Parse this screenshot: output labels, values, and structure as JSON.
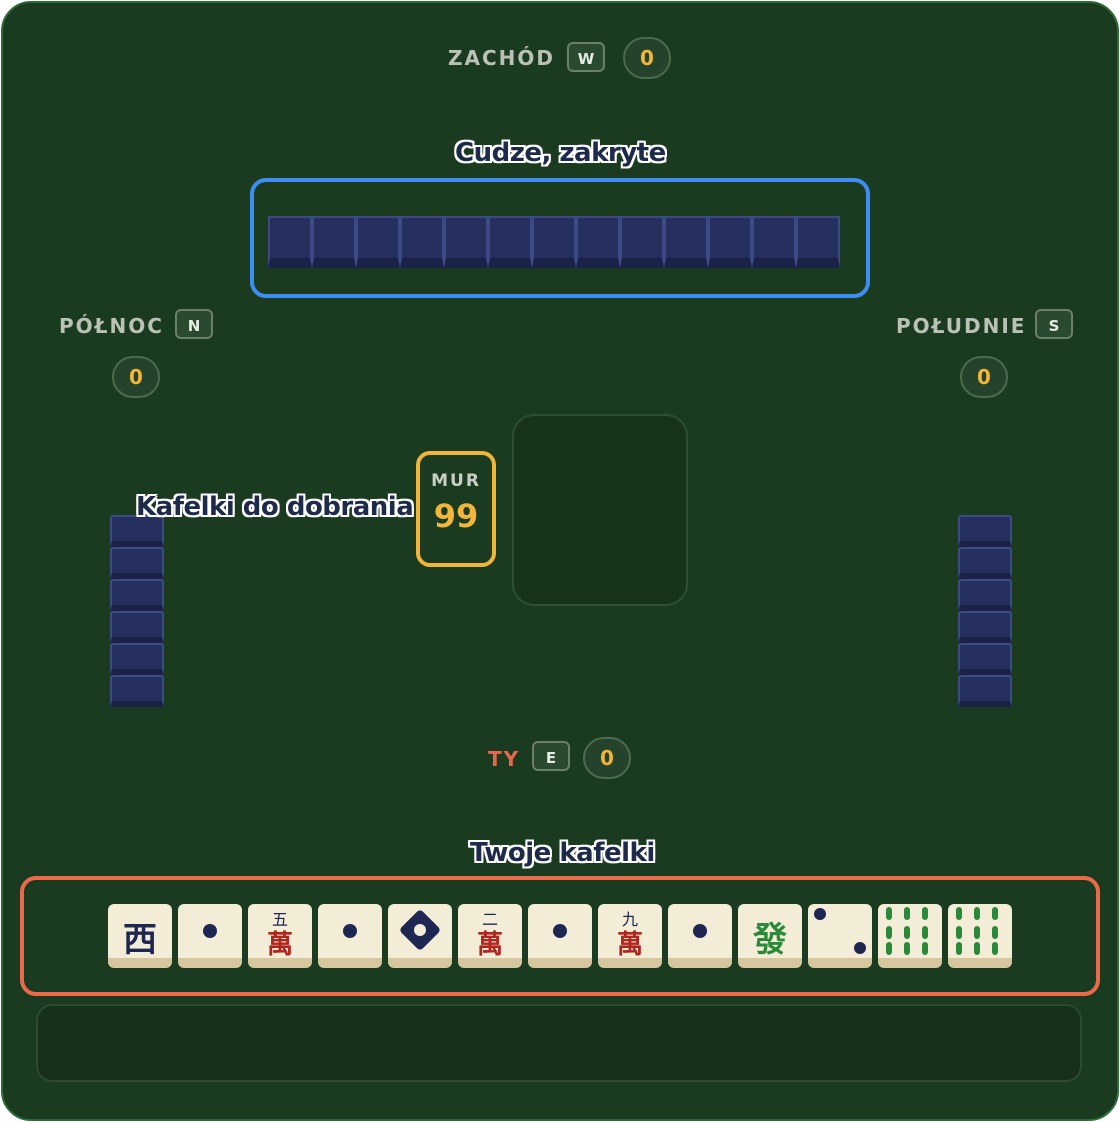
{
  "players": {
    "west": {
      "name": "ZACHÓD",
      "wind": "W",
      "score": "0"
    },
    "north": {
      "name": "PÓŁNOC",
      "wind": "N",
      "score": "0"
    },
    "south": {
      "name": "POŁUDNIE",
      "wind": "S",
      "score": "0"
    },
    "you": {
      "name": "TY",
      "wind": "E",
      "score": "0"
    }
  },
  "annotations": {
    "hidden": "Cudze, zakryte",
    "wall": "Kafelki do dobrania",
    "hand": "Twoje kafelki"
  },
  "wall": {
    "label": "MUR",
    "count": "99"
  },
  "hand": {
    "tiles": [
      {
        "kind": "wind-west",
        "char": "西"
      },
      {
        "kind": "circle-1"
      },
      {
        "kind": "character-5",
        "top": "五",
        "bottom": "萬"
      },
      {
        "kind": "circle-1"
      },
      {
        "kind": "circle-big"
      },
      {
        "kind": "character-2",
        "top": "二",
        "bottom": "萬"
      },
      {
        "kind": "circle-1"
      },
      {
        "kind": "character-9",
        "top": "九",
        "bottom": "萬"
      },
      {
        "kind": "circle-1"
      },
      {
        "kind": "dragon-green",
        "char": "發"
      },
      {
        "kind": "circle-2"
      },
      {
        "kind": "bamboo-6"
      },
      {
        "kind": "bamboo-6"
      }
    ]
  },
  "colors": {
    "accent_blue": "#3d8ef0",
    "accent_orange": "#ec6a4a",
    "gold": "#f1b53a",
    "felt": "#1b3b20"
  }
}
